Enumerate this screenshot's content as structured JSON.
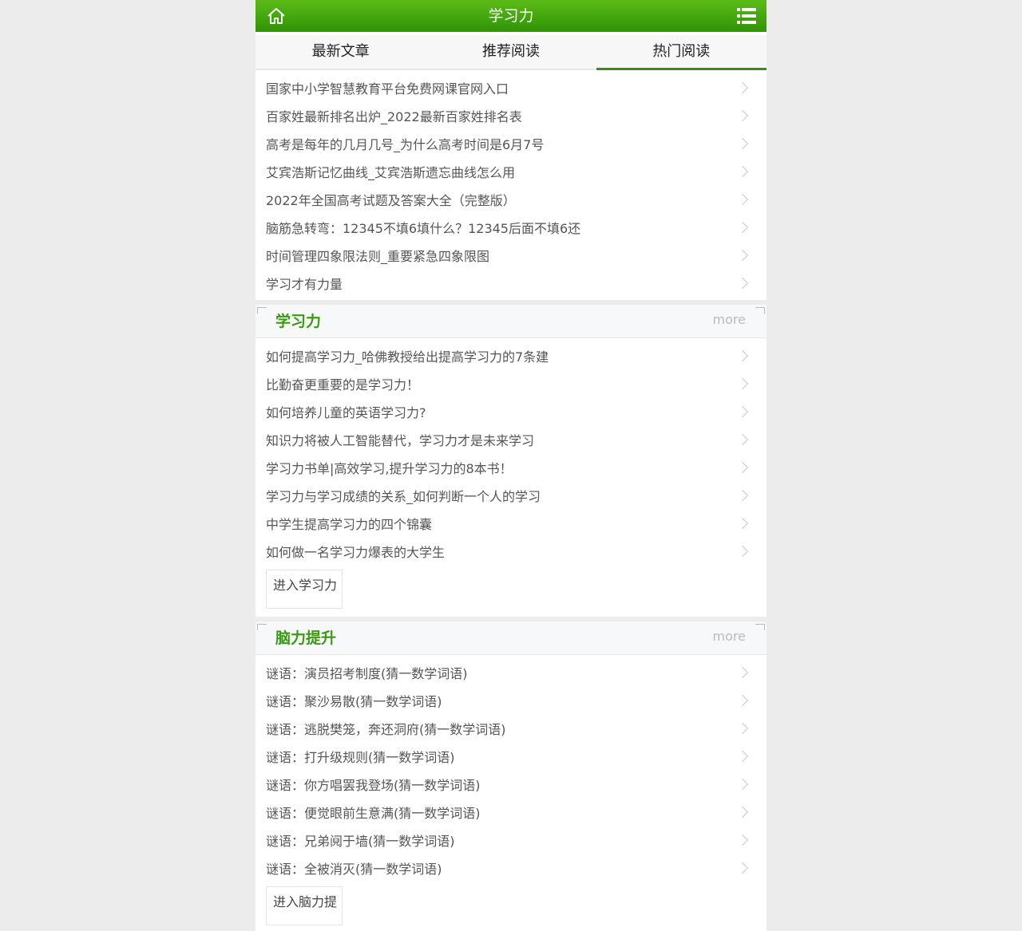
{
  "header": {
    "title": "学习力",
    "home_icon": "home-icon",
    "menu_icon": "list-menu-icon"
  },
  "tabs": [
    {
      "label": "最新文章"
    },
    {
      "label": "推荐阅读"
    },
    {
      "label": "热门阅读",
      "active": true
    }
  ],
  "hot_list": [
    "国家中小学智慧教育平台免费网课官网入口",
    "百家姓最新排名出炉_2022最新百家姓排名表",
    "高考是每年的几月几号_为什么高考时间是6月7号",
    "艾宾浩斯记忆曲线_艾宾浩斯遗忘曲线怎么用",
    "2022年全国高考试题及答案大全（完整版）",
    "脑筋急转弯：12345不填6填什么？12345后面不填6还",
    "时间管理四象限法则_重要紧急四象限图",
    "学习才有力量"
  ],
  "sections": [
    {
      "name": "学习力",
      "more": "more",
      "items": [
        "如何提高学习力_哈佛教授给出提高学习力的7条建",
        "比勤奋更重要的是学习力！",
        "如何培养儿童的英语学习力?",
        "知识力将被人工智能替代，学习力才是未来学习",
        "学习力书单|高效学习,提升学习力的8本书！",
        "学习力与学习成绩的关系_如何判断一个人的学习",
        "中学生提高学习力的四个锦囊",
        "如何做一名学习力爆表的大学生"
      ],
      "enter": "进入学习力"
    },
    {
      "name": "脑力提升",
      "more": "more",
      "items": [
        "谜语：演员招考制度(猜一数学词语)",
        "谜语：聚沙易散(猜一数学词语)",
        "谜语：逃脱樊笼，奔还洞府(猜一数学词语)",
        "谜语：打升级规则(猜一数学词语)",
        "谜语：你方唱罢我登场(猜一数学词语)",
        "谜语：便觉眼前生意满(猜一数学词语)",
        "谜语：兄弟阋于墙(猜一数学词语)",
        "谜语：全被消灭(猜一数学词语)"
      ],
      "enter": "进入脑力提"
    }
  ],
  "colors": {
    "accent": "#2f9406",
    "section_title": "#3a9a12",
    "background": "#ececec"
  }
}
